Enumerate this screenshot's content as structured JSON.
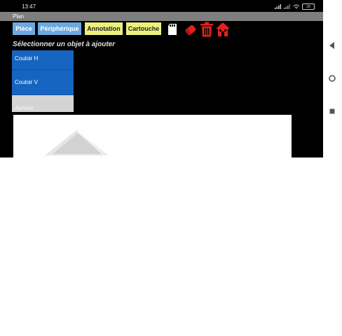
{
  "status_bar": {
    "time": "13:47",
    "battery": "28"
  },
  "window": {
    "title": "Plan"
  },
  "toolbar": {
    "piece_label": "Pièce",
    "peripherique_label": "Périphérique",
    "annotation_label": "Annotation",
    "cartouche_label": "Cartouche",
    "icons": [
      "sd-card-icon",
      "eraser-icon",
      "trash-icon",
      "home-icon"
    ]
  },
  "object_picker": {
    "title": "Sélectionner un objet à ajouter",
    "items": [
      {
        "label": "Couloir H"
      },
      {
        "label": "Couloir V"
      }
    ],
    "cancel_label": "Annuler"
  },
  "colors": {
    "background": "#000000",
    "title_bar": "#7e7e7e",
    "blue_button": "#6aa9e0",
    "yellow_button": "#eef07c",
    "list_item": "#1565c0",
    "tool_icon": "#e02020"
  },
  "nav_bar": {
    "icons": [
      "back-triangle-icon",
      "home-circle-icon",
      "recents-square-icon"
    ]
  }
}
